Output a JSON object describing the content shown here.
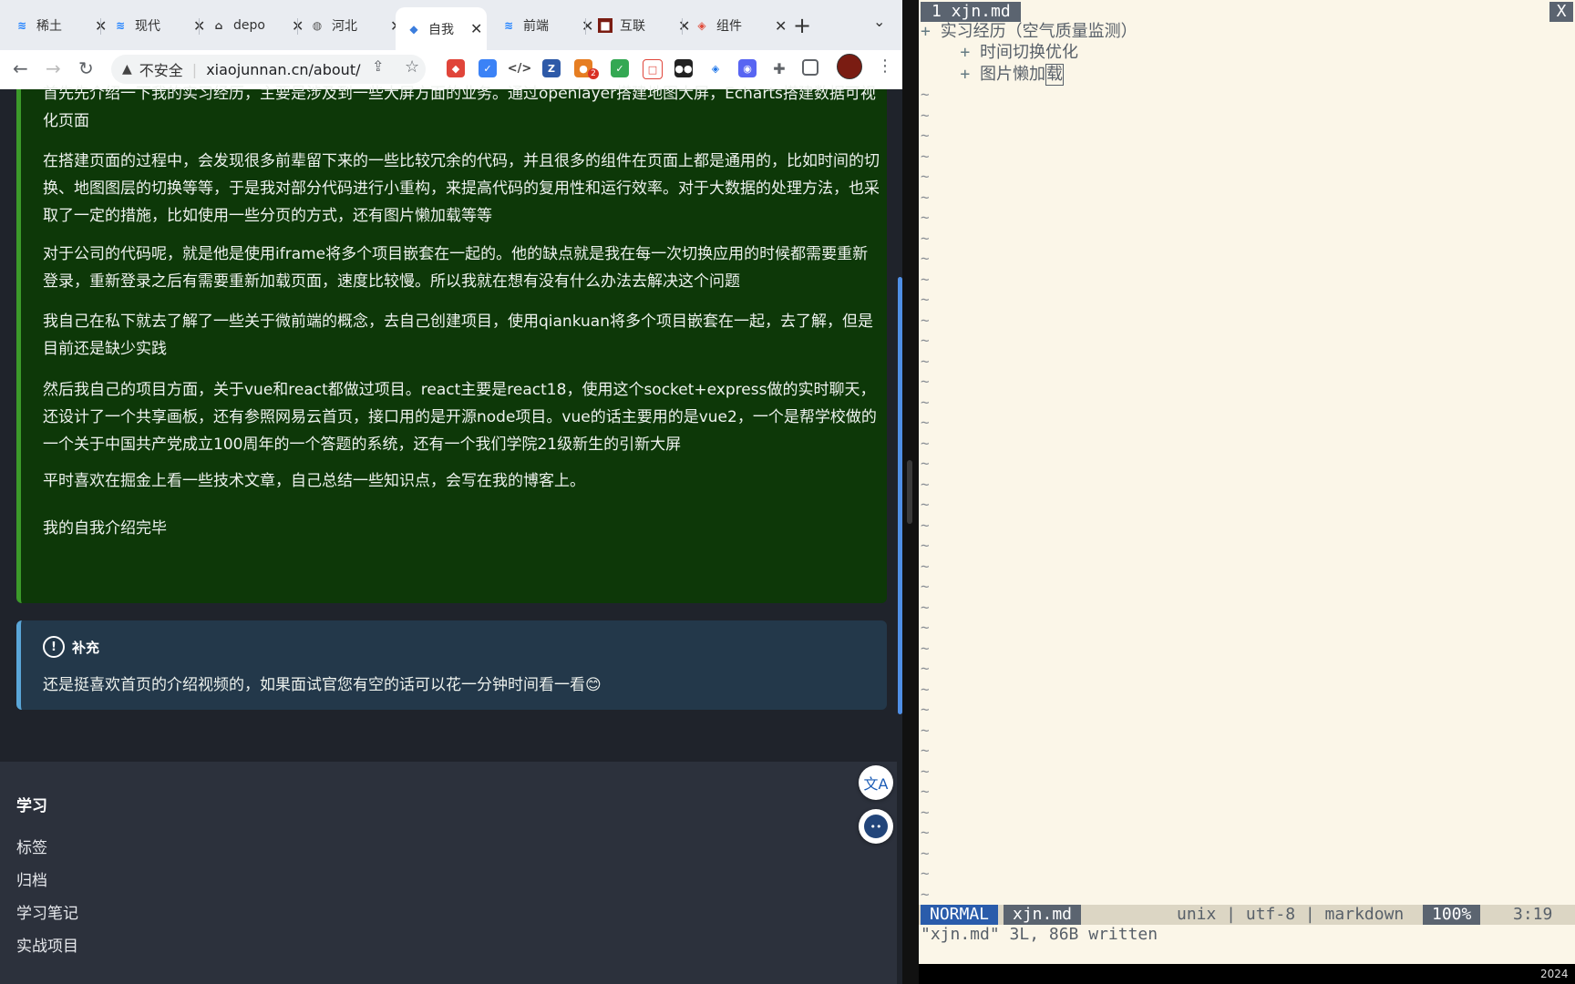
{
  "browser": {
    "tabs": [
      {
        "title": "稀土",
        "icon": "juejin-icon"
      },
      {
        "title": "现代",
        "icon": "juejin-icon"
      },
      {
        "title": "depo",
        "icon": "vercel-icon"
      },
      {
        "title": "河北",
        "icon": "globe-icon"
      },
      {
        "title": "自我",
        "icon": "vuepress-icon"
      },
      {
        "title": "前端",
        "icon": "juejin-icon"
      },
      {
        "title": "互联",
        "icon": "app-icon"
      },
      {
        "title": "组件",
        "icon": "diamond-icon"
      }
    ],
    "new_tab": "+",
    "omnibox": {
      "security": "不安全",
      "url": "xiaojunnan.cn/about/"
    },
    "extension_badge": "2"
  },
  "article": {
    "paragraphs": [
      "首先先介绍一下我的实习经历，主要是涉及到一些大屏方面的业务。通过openlayer搭建地图大屏，Echarts搭建数据可视化页面",
      "在搭建页面的过程中，会发现很多前辈留下来的一些比较冗余的代码，并且很多的组件在页面上都是通用的，比如时间的切换、地图图层的切换等等，于是我对部分代码进行小重构，来提高代码的复用性和运行效率。对于大数据的处理方法，也采取了一定的措施，比如使用一些分页的方式，还有图片懒加载等等",
      "对于公司的代码呢，就是他是使用iframe将多个项目嵌套在一起的。他的缺点就是我在每一次切换应用的时候都需要重新登录，重新登录之后有需要重新加载页面，速度比较慢。所以我就在想有没有什么办法去解决这个问题",
      "我自己在私下就去了解了一些关于微前端的概念，去自己创建项目，使用qiankuan将多个项目嵌套在一起，去了解，但是目前还是缺少实践",
      "然后我自己的项目方面，关于vue和react都做过项目。react主要是react18，使用这个socket+express做的实时聊天，还设计了一个共享画板，还有参照网易云首页，接口用的是开源node项目。vue的话主要用的是vue2，一个是帮学校做的一个关于中国共产党成立100周年的一个答题的系统，还有一个我们学院21级新生的引新大屏",
      "平时喜欢在掘金上看一些技术文章，自己总结一些知识点，会写在我的博客上。",
      "我的自我介绍完毕"
    ],
    "note": {
      "title": "补充",
      "body": "还是挺喜欢首页的介绍视频的，如果面试官您有空的话可以花一分钟时间看一看😊"
    }
  },
  "footer": {
    "title": "学习",
    "links": [
      "标签",
      "归档",
      "学习笔记",
      "实战项目"
    ]
  },
  "vim": {
    "tab_label": "1 xjn.md",
    "close_label": "X",
    "lines": [
      {
        "prefix": "+ ",
        "text": "实习经历（空气质量监测）"
      },
      {
        "prefix": "    + ",
        "text": "时间切换优化"
      },
      {
        "prefix": "    + ",
        "text": "图片懒加",
        "cursor_char": "载"
      }
    ],
    "tilde": "~",
    "status": {
      "mode": "NORMAL",
      "file": "xjn.md",
      "encoding": "unix | utf-8 | markdown",
      "percent": "100%",
      "position": "3:19"
    },
    "message": "\"xjn.md\" 3L, 86B written"
  },
  "clock": "2024"
}
